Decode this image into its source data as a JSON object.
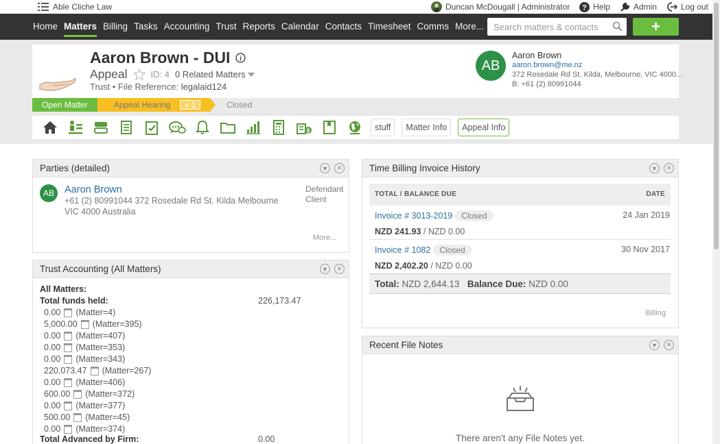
{
  "topbar": {
    "firm": "Able Cliche Law",
    "user": "Duncan McDougall | Administrator",
    "help": "Help",
    "admin": "Admin",
    "logout": "Log out"
  },
  "nav": {
    "links": [
      "Home",
      "Matters",
      "Billing",
      "Tasks",
      "Accounting",
      "Trust",
      "Reports",
      "Calendar",
      "Contacts",
      "Timesheet",
      "Comms",
      "More..."
    ],
    "active": "Matters",
    "search_placeholder": "Search matters & contacts",
    "add_label": "+"
  },
  "matter": {
    "title": "Aaron Brown - DUI",
    "type": "Appeal",
    "id_label": "ID: 4",
    "related": "0 Related Matters",
    "fileref_prefix": "Trust • File Reference:",
    "fileref": "legalaid124"
  },
  "client": {
    "initials": "AB",
    "name": "Aaron Brown",
    "email": "aaron.brown@me.nz",
    "address": "372 Rosedale Rd St. Kilda, Melbourne, VIC 4000...",
    "phone": "B: +61 (2) 80991044"
  },
  "workflow": {
    "open": "Open Matter",
    "current": "Appeal Hearing",
    "plus": "+ 1",
    "closed": "Closed"
  },
  "toolbar": {
    "icons": [
      "home-icon",
      "parties-icon",
      "stack-icon",
      "notes-icon",
      "tasks-icon",
      "comms-icon",
      "bell-icon",
      "folder-icon",
      "chart-icon",
      "calculator-icon",
      "billing-icon",
      "book-icon",
      "globe-icon"
    ],
    "buttons": [
      "stuff",
      "Matter Info",
      "Appeal Info"
    ]
  },
  "parties": {
    "title": "Parties (detailed)",
    "initials": "AB",
    "name": "Aaron Brown",
    "address": "+61 (2) 80991044 372 Rosedale Rd St. Kilda Melbourne VIC 4000 Australia",
    "role1": "Defendant",
    "role2": "Client",
    "more": "More..."
  },
  "trust": {
    "title": "Trust Accounting (All Matters)",
    "all_matters": "All Matters:",
    "total_label": "Total funds held:",
    "total_value": "226,173.47",
    "rows": [
      {
        "amount": "0.00",
        "matter": "(Matter=4)"
      },
      {
        "amount": "5,000.00",
        "matter": "(Matter=395)"
      },
      {
        "amount": "0.00",
        "matter": "(Matter=407)"
      },
      {
        "amount": "0.00",
        "matter": "(Matter=353)"
      },
      {
        "amount": "0.00",
        "matter": "(Matter=343)"
      },
      {
        "amount": "220,073.47",
        "matter": "(Matter=267)"
      },
      {
        "amount": "0.00",
        "matter": "(Matter=406)"
      },
      {
        "amount": "600.00",
        "matter": "(Matter=372)"
      },
      {
        "amount": "0.00",
        "matter": "(Matter=377)"
      },
      {
        "amount": "500.00",
        "matter": "(Matter=45)"
      },
      {
        "amount": "0.00",
        "matter": "(Matter=374)"
      }
    ],
    "advanced_label": "Total Advanced by Firm:",
    "advanced_value": "0.00"
  },
  "invoices": {
    "title": "Time Billing Invoice History",
    "col_total": "TOTAL / BALANCE DUE",
    "col_date": "DATE",
    "items": [
      {
        "label": "Invoice # 3013-2019",
        "status": "Closed",
        "date": "24 Jan 2019",
        "total": "NZD 241.93",
        "balance": "/ NZD 0.00"
      },
      {
        "label": "Invoice # 1082",
        "status": "Closed",
        "date": "30 Nov 2017",
        "total": "NZD 2,402.20",
        "balance": "/ NZD 0.00"
      }
    ],
    "total_label": "Total:",
    "total_value": "NZD 2,644.13",
    "balance_label": "Balance Due:",
    "balance_value": "NZD 0.00",
    "billing_link": "Billing"
  },
  "filenotes": {
    "title": "Recent File Notes",
    "empty": "There aren't any File Notes yet."
  }
}
